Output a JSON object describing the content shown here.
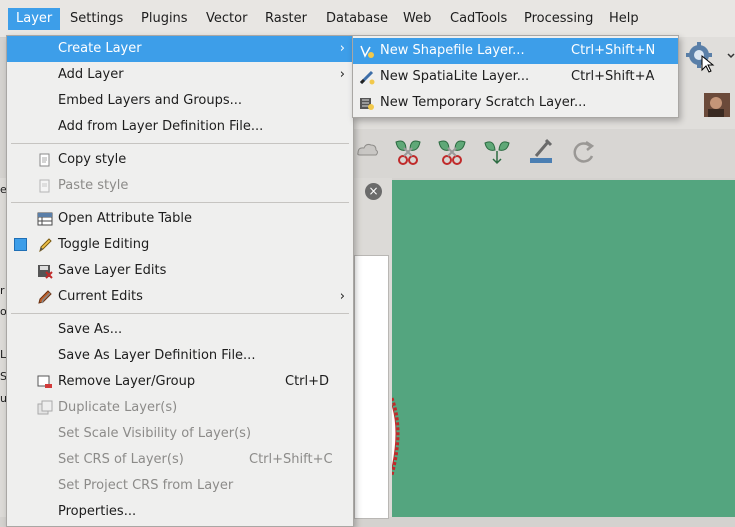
{
  "menubar": {
    "items": [
      {
        "label": "Layer"
      },
      {
        "label": "Settings"
      },
      {
        "label": "Plugins"
      },
      {
        "label": "Vector"
      },
      {
        "label": "Raster"
      },
      {
        "label": "Database"
      },
      {
        "label": "Web"
      },
      {
        "label": "CadTools"
      },
      {
        "label": "Processing"
      },
      {
        "label": "Help"
      }
    ]
  },
  "layer_menu": {
    "items": [
      {
        "label": "Create Layer",
        "icon": "none",
        "submenu": true,
        "highlighted": true
      },
      {
        "label": "Add Layer",
        "icon": "none",
        "submenu": true
      },
      {
        "label": "Embed Layers and Groups...",
        "icon": "none"
      },
      {
        "label": "Add from Layer Definition File...",
        "icon": "none"
      },
      {
        "label": "Copy style",
        "icon": "copy-style-icon"
      },
      {
        "label": "Paste style",
        "icon": "paste-style-icon",
        "disabled": true
      },
      {
        "label": "Open Attribute Table",
        "icon": "attribute-table-icon"
      },
      {
        "label": "Toggle Editing",
        "icon": "pencil-icon",
        "checked": true
      },
      {
        "label": "Save Layer Edits",
        "icon": "save-edits-icon"
      },
      {
        "label": "Current Edits",
        "icon": "current-edits-icon",
        "submenu": true
      },
      {
        "label": "Save As...",
        "icon": "none"
      },
      {
        "label": "Save As Layer Definition File...",
        "icon": "none"
      },
      {
        "label": "Remove Layer/Group",
        "icon": "remove-layer-icon",
        "shortcut": "Ctrl+D"
      },
      {
        "label": "Duplicate Layer(s)",
        "icon": "duplicate-layer-icon",
        "disabled": true
      },
      {
        "label": "Set Scale Visibility of Layer(s)",
        "icon": "none",
        "disabled": true
      },
      {
        "label": "Set CRS of Layer(s)",
        "icon": "none",
        "shortcut": "Ctrl+Shift+C",
        "disabled": true
      },
      {
        "label": "Set Project CRS from Layer",
        "icon": "none",
        "disabled": true
      },
      {
        "label": "Properties...",
        "icon": "none"
      }
    ]
  },
  "create_layer_submenu": {
    "items": [
      {
        "label": "New Shapefile Layer...",
        "shortcut": "Ctrl+Shift+N",
        "icon": "new-shapefile-icon",
        "highlighted": true
      },
      {
        "label": "New SpatiaLite Layer...",
        "shortcut": "Ctrl+Shift+A",
        "icon": "new-spatialite-icon"
      },
      {
        "label": "New Temporary Scratch Layer...",
        "icon": "new-scratch-layer-icon"
      }
    ]
  },
  "background": {
    "panel_close": "×",
    "left_edge_fragments": [
      "el",
      "r",
      "o",
      "L",
      "S",
      "u"
    ]
  },
  "colors": {
    "accent": "#3d9ee9",
    "map_canvas": "#54a57f",
    "menu_bg": "#efefee"
  }
}
